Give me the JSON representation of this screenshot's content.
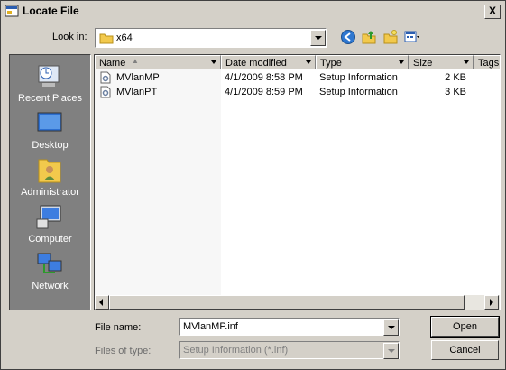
{
  "window": {
    "title": "Locate File",
    "close_label": "X"
  },
  "toolbar": {
    "lookin_label": "Look in:",
    "lookin_value": "x64",
    "icons": [
      "back-icon",
      "up-folder-icon",
      "new-folder-icon",
      "view-menu-icon"
    ]
  },
  "places": [
    {
      "label": "Recent Places",
      "icon": "recent-places-icon"
    },
    {
      "label": "Desktop",
      "icon": "desktop-icon"
    },
    {
      "label": "Administrator",
      "icon": "user-folder-icon"
    },
    {
      "label": "Computer",
      "icon": "computer-icon"
    },
    {
      "label": "Network",
      "icon": "network-icon"
    }
  ],
  "list": {
    "columns": [
      "Name",
      "Date modified",
      "Type",
      "Size",
      "Tags"
    ],
    "rows": [
      {
        "name": "MVlanMP",
        "date": "4/1/2009 8:58 PM",
        "type": "Setup Information",
        "size": "2 KB"
      },
      {
        "name": "MVlanPT",
        "date": "4/1/2009 8:59 PM",
        "type": "Setup Information",
        "size": "3 KB"
      }
    ]
  },
  "form": {
    "filename_label": "File name:",
    "filename_value": "MVlanMP.inf",
    "filetype_label": "Files of type:",
    "filetype_value": "Setup Information (*.inf)"
  },
  "buttons": {
    "open": "Open",
    "cancel": "Cancel"
  }
}
